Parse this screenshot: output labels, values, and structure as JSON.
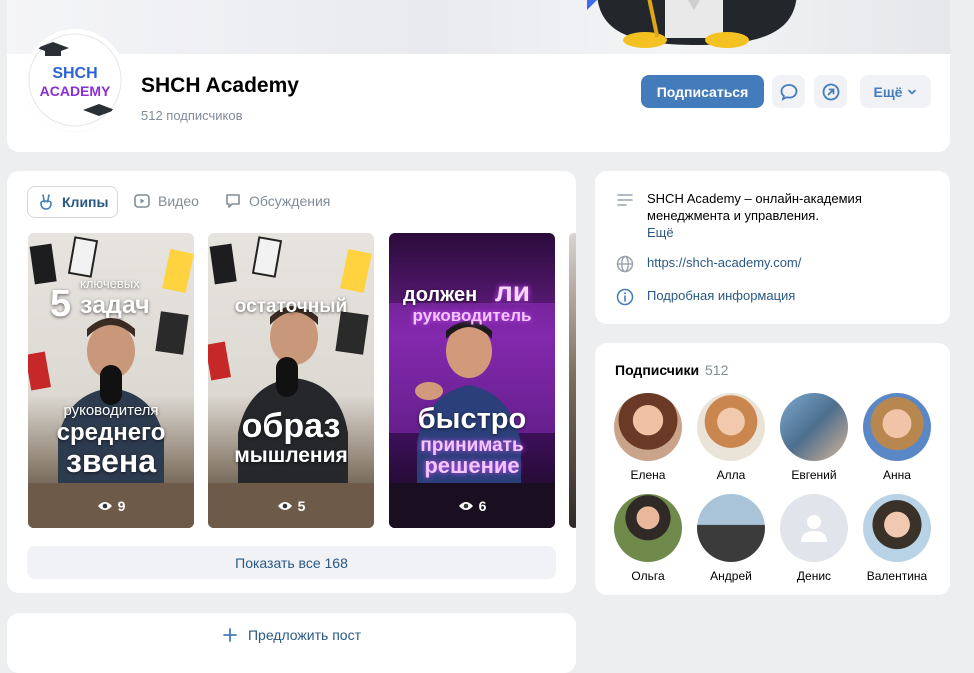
{
  "header": {
    "community_name": "SHCH Academy",
    "subscribers": "512 подписчиков",
    "avatar_text_line1": "SHCH",
    "avatar_text_line2": "ACADEMY",
    "subscribe_label": "Подписаться",
    "more_label": "Ещё",
    "accent_color": "#447bba"
  },
  "tabs": [
    {
      "label": "Клипы",
      "icon": "clips-icon",
      "active": true
    },
    {
      "label": "Видео",
      "icon": "video-icon",
      "active": false
    },
    {
      "label": "Обсуждения",
      "icon": "discussion-icon",
      "active": false
    }
  ],
  "clips": [
    {
      "cap_top1": "5",
      "cap_top2": "ключевых",
      "cap_top3": "задач",
      "cap_mid": "руководителя",
      "cap_b1": "среднего",
      "cap_b2": "звена",
      "views": "9"
    },
    {
      "cap_top1": "остаточный",
      "cap_b1": "образ",
      "cap_b2": "мышления",
      "views": "5"
    },
    {
      "cap_top1": "должен",
      "cap_top2": "ли",
      "cap_top3": "руководитель",
      "cap_b1": "быстро",
      "cap_b2": "принимать",
      "cap_b3": "решение",
      "views": "6"
    }
  ],
  "show_all_label": "Показать все 168",
  "about": {
    "description": "SHCH Academy – онлайн-академия менеджмента и управления.",
    "more": "Ещё",
    "link": "https://shch-academy.com/",
    "details": "Подробная информация"
  },
  "followers": {
    "title": "Подписчики",
    "count": "512",
    "people": [
      "Елена",
      "Алла",
      "Евгений",
      "Анна",
      "Ольга",
      "Андрей",
      "Денис",
      "Валентина"
    ]
  },
  "suggest_label": "Предложить пост"
}
